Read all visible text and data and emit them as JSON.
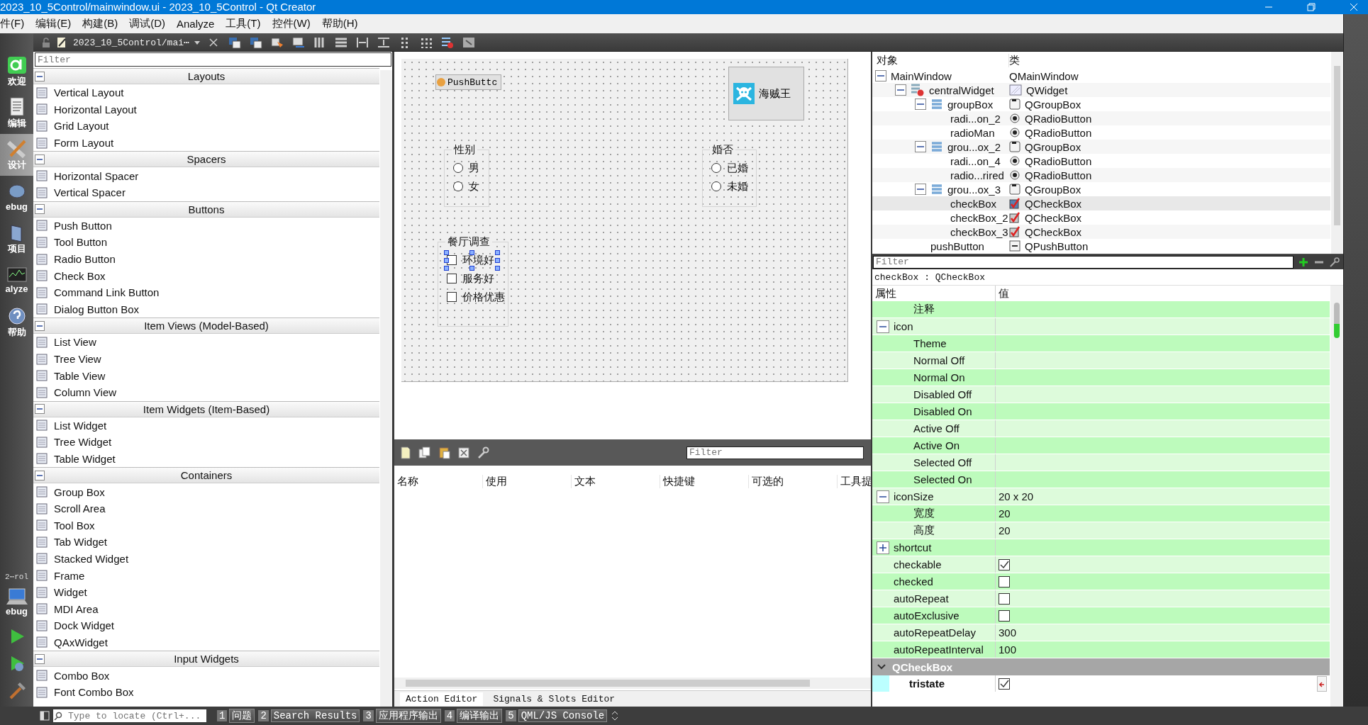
{
  "window": {
    "title": "2023_10_5Control/mainwindow.ui - 2023_10_5Control - Qt Creator"
  },
  "menu": [
    "件(F)",
    "编辑(E)",
    "构建(B)",
    "调试(D)",
    "Analyze",
    "工具(T)",
    "控件(W)",
    "帮助(H)"
  ],
  "toolbar": {
    "file_tab": "2023_10_5Control/mai⋯"
  },
  "mode_bar": {
    "items": [
      {
        "label": "欢迎",
        "kind": "welcome",
        "selected": false
      },
      {
        "label": "编辑",
        "kind": "edit",
        "selected": false
      },
      {
        "label": "设计",
        "kind": "design",
        "selected": true
      },
      {
        "label": "ebug",
        "kind": "debug",
        "selected": false
      },
      {
        "label": "项目",
        "kind": "projects",
        "selected": false
      },
      {
        "label": "alyze",
        "kind": "analyze",
        "selected": false
      },
      {
        "label": "帮助",
        "kind": "help",
        "selected": false
      }
    ],
    "kit": {
      "project": "2⋯rol",
      "label": "ebug"
    }
  },
  "widget_box": {
    "filter_placeholder": "Filter",
    "categories": [
      {
        "title": "Layouts",
        "expanded": true,
        "items": [
          "Vertical Layout",
          "Horizontal Layout",
          "Grid Layout",
          "Form Layout"
        ]
      },
      {
        "title": "Spacers",
        "expanded": true,
        "items": [
          "Horizontal Spacer",
          "Vertical Spacer"
        ]
      },
      {
        "title": "Buttons",
        "expanded": true,
        "items": [
          "Push Button",
          "Tool Button",
          "Radio Button",
          "Check Box",
          "Command Link Button",
          "Dialog Button Box"
        ]
      },
      {
        "title": "Item Views (Model-Based)",
        "expanded": true,
        "items": [
          "List View",
          "Tree View",
          "Table View",
          "Column View"
        ]
      },
      {
        "title": "Item Widgets (Item-Based)",
        "expanded": true,
        "items": [
          "List Widget",
          "Tree Widget",
          "Table Widget"
        ]
      },
      {
        "title": "Containers",
        "expanded": true,
        "items": [
          "Group Box",
          "Scroll Area",
          "Tool Box",
          "Tab Widget",
          "Stacked Widget",
          "Frame",
          "Widget",
          "MDI Area",
          "Dock Widget",
          "QAxWidget"
        ]
      },
      {
        "title": "Input Widgets",
        "expanded": true,
        "items": [
          "Combo Box",
          "Font Combo Box"
        ]
      }
    ]
  },
  "form": {
    "push_button": {
      "label": "PushButtc"
    },
    "icon_button": {
      "label": "海贼王"
    },
    "groups": [
      {
        "title": "性别",
        "items": [
          {
            "label": "男",
            "kind": "radio",
            "checked": false,
            "selected": false
          },
          {
            "label": "女",
            "kind": "radio",
            "checked": false,
            "selected": false
          }
        ]
      },
      {
        "title": "婚否",
        "items": [
          {
            "label": "已婚",
            "kind": "radio",
            "checked": false,
            "selected": false
          },
          {
            "label": "未婚",
            "kind": "radio",
            "checked": false,
            "selected": false
          }
        ]
      },
      {
        "title": "餐厅调查",
        "items": [
          {
            "label": "环境好",
            "kind": "checkbox",
            "checked": false,
            "selected": true
          },
          {
            "label": "服务好",
            "kind": "checkbox",
            "checked": false,
            "selected": false
          },
          {
            "label": "价格优惠",
            "kind": "checkbox",
            "checked": false,
            "selected": false
          }
        ]
      }
    ]
  },
  "action_editor": {
    "filter_placeholder": "Filter",
    "columns": [
      "名称",
      "使用",
      "文本",
      "快捷键",
      "可选的",
      "工具提"
    ],
    "tabs": [
      {
        "label": "Action Editor",
        "selected": true
      },
      {
        "label": "Signals & Slots Editor",
        "selected": false
      }
    ]
  },
  "object_inspector": {
    "columns": [
      "对象",
      "类"
    ],
    "tree": [
      {
        "object": "MainWindow",
        "class": "QMainWindow",
        "selected": false,
        "expanded": true,
        "children": [
          {
            "object": "centralWidget",
            "class": "QWidget",
            "kind": "widget",
            "layout": {
              "kind": "broken"
            },
            "selected": false,
            "expanded": true,
            "children": [
              {
                "object": "groupBox",
                "class": "QGroupBox",
                "kind": "groupbox",
                "layout": {
                  "kind": "vertical"
                },
                "selected": false,
                "expanded": true,
                "children": [
                  {
                    "object": "radi...on_2",
                    "class": "QRadioButton",
                    "kind": "radio",
                    "selected": false
                  },
                  {
                    "object": "radioMan",
                    "class": "QRadioButton",
                    "kind": "radio",
                    "selected": false
                  }
                ]
              },
              {
                "object": "grou...ox_2",
                "class": "QGroupBox",
                "kind": "groupbox",
                "layout": {
                  "kind": "vertical"
                },
                "selected": false,
                "expanded": true,
                "children": [
                  {
                    "object": "radi...on_4",
                    "class": "QRadioButton",
                    "kind": "radio",
                    "selected": false
                  },
                  {
                    "object": "radio...rired",
                    "class": "QRadioButton",
                    "kind": "radio",
                    "selected": false
                  }
                ]
              },
              {
                "object": "grou...ox_3",
                "class": "QGroupBox",
                "kind": "groupbox",
                "layout": {
                  "kind": "vertical"
                },
                "selected": false,
                "expanded": true,
                "children": [
                  {
                    "object": "checkBox",
                    "class": "QCheckBox",
                    "kind": "checkbox",
                    "selected": true
                  },
                  {
                    "object": "checkBox_2",
                    "class": "QCheckBox",
                    "kind": "checkbox",
                    "selected": false
                  },
                  {
                    "object": "checkBox_3",
                    "class": "QCheckBox",
                    "kind": "checkbox",
                    "selected": false
                  }
                ]
              },
              {
                "object": "pushButton",
                "class": "QPushButton",
                "kind": "pushbutton",
                "selected": false
              }
            ]
          }
        ]
      }
    ]
  },
  "property_editor": {
    "filter_placeholder": "Filter",
    "current": "checkBox : QCheckBox",
    "columns": [
      "属性",
      "值"
    ],
    "sections": [
      {
        "properties": [
          {
            "name": "注释",
            "kind": "sub"
          },
          {
            "name": "icon",
            "kind": "property",
            "expanded": true,
            "children": [
              {
                "name": "Theme"
              },
              {
                "name": "Normal Off"
              },
              {
                "name": "Normal On"
              },
              {
                "name": "Disabled Off"
              },
              {
                "name": "Disabled On"
              },
              {
                "name": "Active Off"
              },
              {
                "name": "Active On"
              },
              {
                "name": "Selected Off"
              },
              {
                "name": "Selected On"
              }
            ]
          },
          {
            "name": "iconSize",
            "kind": "property",
            "value": "20 x 20",
            "expanded": true,
            "children": [
              {
                "name": "宽度",
                "value": "20"
              },
              {
                "name": "高度",
                "value": "20"
              }
            ]
          },
          {
            "name": "shortcut",
            "kind": "property",
            "expanded": false
          },
          {
            "name": "checkable",
            "kind": "property",
            "checked": true
          },
          {
            "name": "checked",
            "kind": "property",
            "checked": false
          },
          {
            "name": "autoRepeat",
            "kind": "property",
            "checked": false
          },
          {
            "name": "autoExclusive",
            "kind": "property",
            "checked": false
          },
          {
            "name": "autoRepeatDelay",
            "kind": "property",
            "value": "300"
          },
          {
            "name": "autoRepeatInterval",
            "kind": "property",
            "value": "100"
          }
        ]
      },
      {
        "title": "QCheckBox",
        "expanded": true,
        "properties": [
          {
            "name": "tristate",
            "kind": "property",
            "checked": true,
            "changed": true
          }
        ]
      }
    ]
  },
  "status_bar": {
    "locate_placeholder": "Type to locate (Ctrl+...",
    "tabs": [
      {
        "number": "1",
        "label": "问题"
      },
      {
        "number": "2",
        "label": "Search Results"
      },
      {
        "number": "3",
        "label": "应用程序输出"
      },
      {
        "number": "4",
        "label": "编译输出"
      },
      {
        "number": "5",
        "label": "QML/JS Console"
      }
    ]
  }
}
